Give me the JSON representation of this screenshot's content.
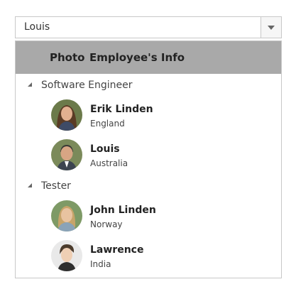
{
  "combo": {
    "value": "Louis"
  },
  "header": {
    "photo_label": "Photo",
    "info_label": "Employee's Info"
  },
  "groups": [
    {
      "label": "Software Engineer",
      "employees": [
        {
          "name": "Erik Linden",
          "location": "England",
          "hair": "#5a3b25",
          "skin": "#e2b090",
          "bg": "#6b7a4a"
        },
        {
          "name": "Louis",
          "location": "Australia",
          "hair": "#3a3a35",
          "skin": "#d7a584",
          "bg": "#7b8a5a"
        }
      ]
    },
    {
      "label": "Tester",
      "employees": [
        {
          "name": "John Linden",
          "location": "Norway",
          "hair": "#c7a46a",
          "skin": "#e8c3a0",
          "bg": "#7e9a66"
        },
        {
          "name": "Lawrence",
          "location": "India",
          "hair": "#4b3b2c",
          "skin": "#efcfb4",
          "bg": "#e9e9e9"
        }
      ]
    }
  ]
}
